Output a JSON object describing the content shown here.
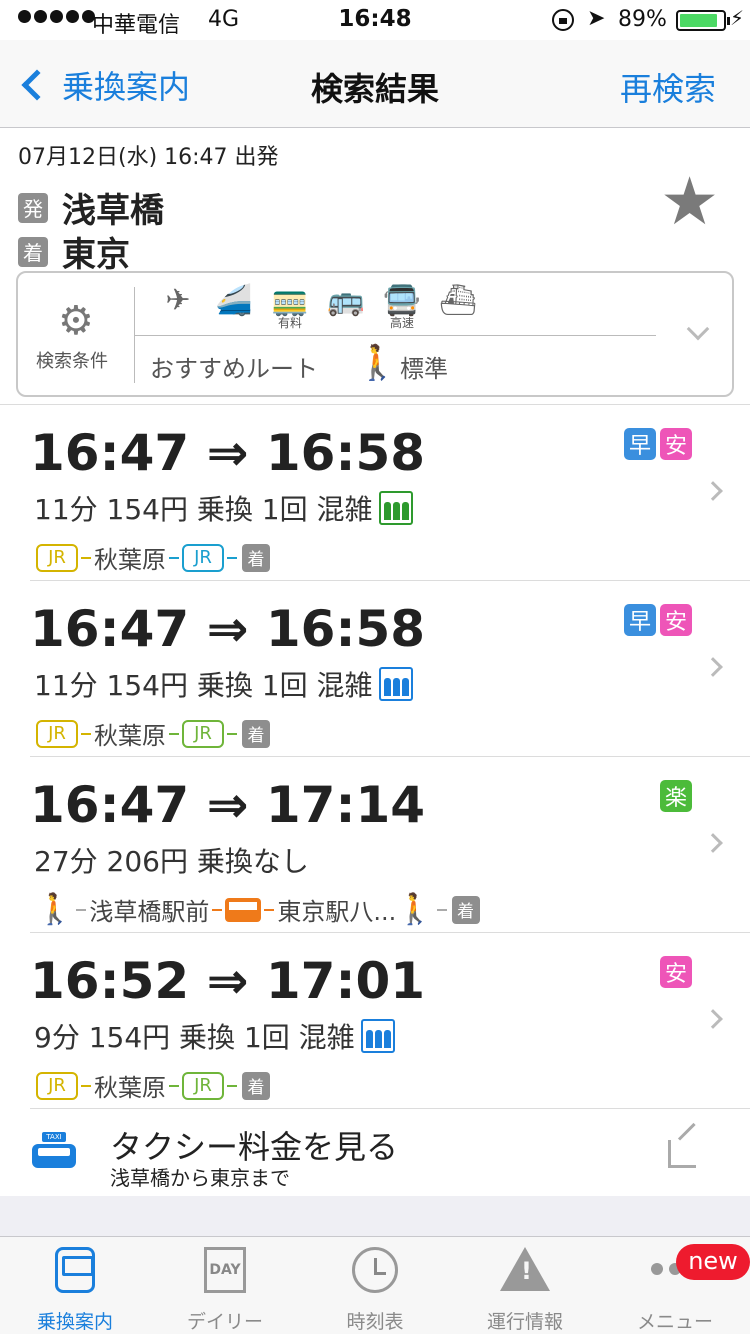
{
  "status_bar": {
    "carrier": "中華電信",
    "network": "4G",
    "time": "16:48",
    "battery": "89%",
    "battery_level": 0.89
  },
  "nav": {
    "back_label": "乗換案内",
    "title": "検索結果",
    "right_label": "再検索"
  },
  "search": {
    "datetime": "07月12日(水) 16:47 出発",
    "from_badge": "発",
    "from": "浅草橋",
    "to_badge": "着",
    "to": "東京",
    "conditions_label": "検索条件",
    "modes": [
      {
        "icon": "airplane-icon",
        "glyph": "✈",
        "sub": ""
      },
      {
        "icon": "shinkansen-icon",
        "glyph": "🚄",
        "sub": ""
      },
      {
        "icon": "limited-express-icon",
        "glyph": "🚃",
        "sub": "有料"
      },
      {
        "icon": "bus-icon",
        "glyph": "🚌",
        "sub": ""
      },
      {
        "icon": "highway-bus-icon",
        "glyph": "🚍",
        "sub": "高速"
      },
      {
        "icon": "ferry-icon",
        "glyph": "⛴",
        "sub": ""
      }
    ],
    "route_pref": "おすすめルート",
    "walk_pref": "標準"
  },
  "routes": [
    {
      "times": "16:47 ⇒ 16:58",
      "info": "11分 154円 乗換 1回 混雑",
      "crowd_color": "#2e9a2e",
      "tags": [
        {
          "label": "早",
          "color": "#3a8fde"
        },
        {
          "label": "安",
          "color": "#ee55b8"
        }
      ],
      "segments": [
        {
          "type": "line",
          "label": "JR",
          "color": "#d4b400"
        },
        {
          "type": "station",
          "label": "秋葉原"
        },
        {
          "type": "line",
          "label": "JR",
          "color": "#1a9fcf"
        },
        {
          "type": "arrive",
          "label": "着"
        }
      ]
    },
    {
      "times": "16:47 ⇒ 16:58",
      "info": "11分 154円 乗換 1回 混雑",
      "crowd_color": "#1a7fdc",
      "tags": [
        {
          "label": "早",
          "color": "#3a8fde"
        },
        {
          "label": "安",
          "color": "#ee55b8"
        }
      ],
      "segments": [
        {
          "type": "line",
          "label": "JR",
          "color": "#d4b400"
        },
        {
          "type": "station",
          "label": "秋葉原"
        },
        {
          "type": "line",
          "label": "JR",
          "color": "#6fb53a"
        },
        {
          "type": "arrive",
          "label": "着"
        }
      ]
    },
    {
      "times": "16:47 ⇒ 17:14",
      "info": "27分 206円 乗換なし",
      "crowd_color": "",
      "tags": [
        {
          "label": "楽",
          "color": "#4cbb3a"
        }
      ],
      "segments": [
        {
          "type": "walk"
        },
        {
          "type": "station",
          "label": "浅草橋駅前"
        },
        {
          "type": "bus"
        },
        {
          "type": "station",
          "label": "東京駅八..."
        },
        {
          "type": "walk"
        },
        {
          "type": "arrive",
          "label": "着"
        }
      ]
    },
    {
      "times": "16:52 ⇒ 17:01",
      "info": "9分 154円 乗換 1回 混雑",
      "crowd_color": "#1a7fdc",
      "tags": [
        {
          "label": "安",
          "color": "#ee55b8"
        }
      ],
      "segments": [
        {
          "type": "line",
          "label": "JR",
          "color": "#d4b400"
        },
        {
          "type": "station",
          "label": "秋葉原"
        },
        {
          "type": "line",
          "label": "JR",
          "color": "#6fb53a"
        },
        {
          "type": "arrive",
          "label": "着"
        }
      ]
    }
  ],
  "taxi": {
    "icon_text": "TAXI",
    "title": "タクシー料金を見る",
    "subtitle": "浅草橋から東京まで"
  },
  "tabbar": {
    "tabs": [
      {
        "label": "乗換案内",
        "icon": "train-icon",
        "active": true
      },
      {
        "label": "デイリー",
        "icon": "day-calendar-icon",
        "active": false
      },
      {
        "label": "時刻表",
        "icon": "clock-icon",
        "active": false
      },
      {
        "label": "運行情報",
        "icon": "warning-icon",
        "active": false
      },
      {
        "label": "メニュー",
        "icon": "more-icon",
        "active": false
      }
    ],
    "day_icon_text": "DAY",
    "new_badge": "new"
  }
}
